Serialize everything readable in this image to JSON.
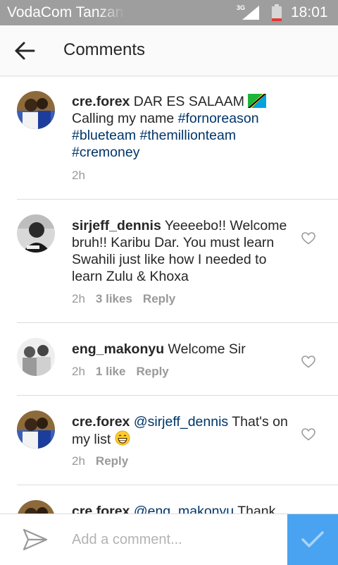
{
  "status_bar": {
    "carrier": "VodaCom Tanzan",
    "network": "3G",
    "time": "18:01"
  },
  "header": {
    "back_icon": "arrow-left-icon",
    "title": "Comments"
  },
  "comments": [
    {
      "username": "cre.forex",
      "text_main": " DAR ES SALAAM ",
      "emoji": "tanzania-flag-emoji",
      "line2": "Calling my name ",
      "hashtags": [
        "#fornoreason",
        "#blueteam",
        "#themillionteam",
        "#cremoney"
      ],
      "time": "2h"
    },
    {
      "username": "sirjeff_dennis",
      "text": " Yeeeebo!! Welcome bruh!! Karibu Dar. You must learn Swahili just like how I needed to learn Zulu & Khoxa",
      "time": "2h",
      "likes": "3 likes",
      "reply": "Reply"
    },
    {
      "username": "eng_makonyu",
      "text": " Welcome Sir",
      "time": "2h",
      "likes": "1 like",
      "reply": "Reply"
    },
    {
      "username": "cre.forex",
      "mention": "@sirjeff_dennis",
      "text": " That's on my list ",
      "emoji": "grinning-face-emoji",
      "time": "2h",
      "reply": "Reply"
    },
    {
      "username": "cre.forex",
      "mention": "@eng_makonyu",
      "text": " Thank"
    }
  ],
  "compose": {
    "placeholder": "Add a comment...",
    "send_icon": "paper-plane-icon",
    "post_icon": "checkmark-icon"
  },
  "colors": {
    "status_bar": "#9e9e9e",
    "link": "#003569",
    "meta": "#999999",
    "post_button": "#4aa3f0"
  }
}
